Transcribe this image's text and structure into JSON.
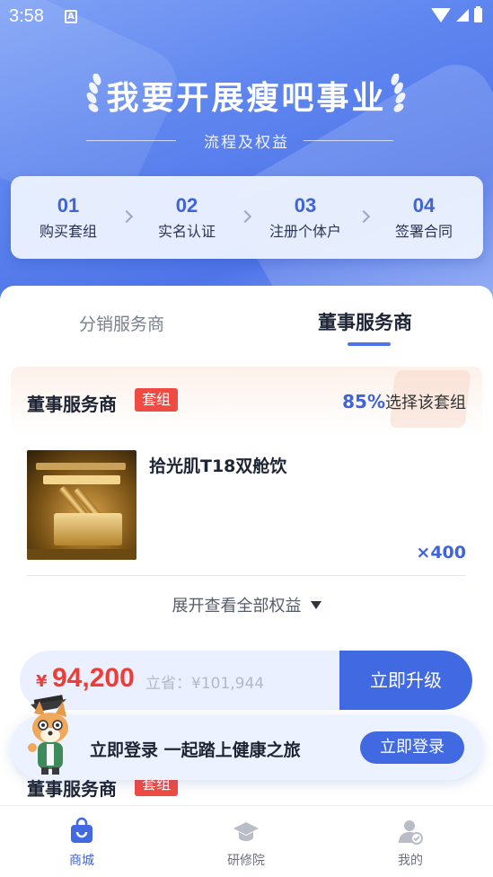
{
  "status_bar": {
    "time": "3:58",
    "notification_glyph": "A"
  },
  "hero": {
    "headline": "我要开展瘦吧事业",
    "subtitle": "流程及权益",
    "steps": [
      {
        "num": "01",
        "label": "购买套组"
      },
      {
        "num": "02",
        "label": "实名认证"
      },
      {
        "num": "03",
        "label": "注册个体户"
      },
      {
        "num": "04",
        "label": "签署合同"
      }
    ]
  },
  "tabs": {
    "inactive": "分销服务商",
    "active": "董事服务商"
  },
  "package": {
    "title": "董事服务商",
    "tag": "套组",
    "percent": "85%",
    "percent_suffix": "选择该套组",
    "product_name": "拾光肌T18双舱饮",
    "quantity": "×400",
    "expand_label": "展开查看全部权益"
  },
  "buy_bar": {
    "currency": "¥",
    "price": "94,200",
    "savings": "立省：¥101,944",
    "button": "立即升级"
  },
  "login_banner": {
    "text": "立即登录 一起踏上健康之旅",
    "button": "立即登录"
  },
  "next_package": {
    "title": "董事服务商",
    "tag": "套组"
  },
  "bottom_nav": {
    "items": [
      {
        "label": "商城",
        "icon": "shopping-bag-icon",
        "active": true
      },
      {
        "label": "研修院",
        "icon": "graduation-cap-icon",
        "active": false
      },
      {
        "label": "我的",
        "icon": "user-icon",
        "active": false
      }
    ]
  },
  "colors": {
    "accent": "#4169e1",
    "price_red": "#ee3d36",
    "tag_red": "#f04b43"
  }
}
